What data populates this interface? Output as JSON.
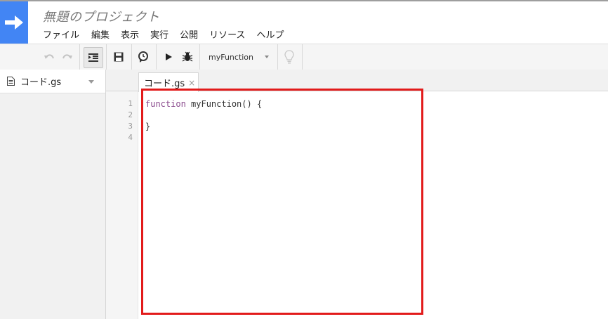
{
  "app": {
    "project_title": "無題のプロジェクト"
  },
  "menubar": {
    "items": [
      "ファイル",
      "編集",
      "表示",
      "実行",
      "公開",
      "リソース",
      "ヘルプ"
    ]
  },
  "toolbar": {
    "function_selector": "myFunction",
    "icons": [
      "undo-icon",
      "redo-icon",
      "indent-icon",
      "save-icon",
      "trigger-clock-icon",
      "run-icon",
      "debug-bug-icon",
      "lightbulb-icon"
    ]
  },
  "sidebar": {
    "file_name": "コード.gs"
  },
  "editor": {
    "tab_label": "コード.gs",
    "tab_close": "×",
    "line_numbers": [
      "1",
      "2",
      "3",
      "4"
    ],
    "code": {
      "line1_keyword": "function",
      "line1_rest": " myFunction() {",
      "line2": "",
      "line3": "}",
      "line4": ""
    }
  },
  "colors": {
    "brand": "#4285f4",
    "annotation_box": "#e21b1b",
    "keyword": "#8a4a8d"
  }
}
